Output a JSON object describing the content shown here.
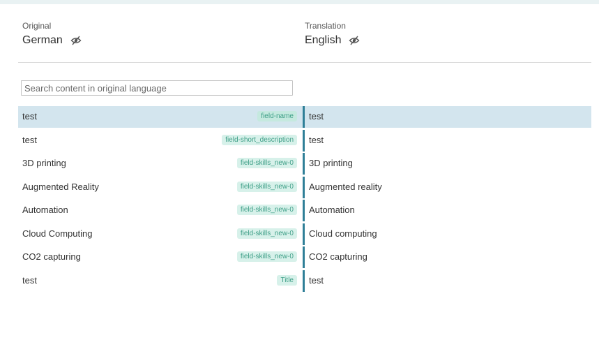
{
  "original": {
    "caption": "Original",
    "language": "German"
  },
  "translation": {
    "caption": "Translation",
    "language": "English"
  },
  "icons": {
    "visibility": "eye-slash-icon"
  },
  "colors": {
    "accent": "#2f7f97",
    "tag_bg": "#d7f1ea",
    "tag_text": "#3d9e86",
    "selected_row": "#d3e5ee"
  },
  "search": {
    "placeholder": "Search content in original language",
    "value": ""
  },
  "rows": [
    {
      "original": "test",
      "tag": "field-name",
      "translation": "test",
      "selected": true
    },
    {
      "original": "test",
      "tag": "field-short_description",
      "translation": "test",
      "selected": false
    },
    {
      "original": "3D printing",
      "tag": "field-skills_new-0",
      "translation": "3D printing",
      "selected": false
    },
    {
      "original": "Augmented Reality",
      "tag": "field-skills_new-0",
      "translation": "Augmented reality",
      "selected": false
    },
    {
      "original": "Automation",
      "tag": "field-skills_new-0",
      "translation": "Automation",
      "selected": false
    },
    {
      "original": "Cloud Computing",
      "tag": "field-skills_new-0",
      "translation": "Cloud computing",
      "selected": false
    },
    {
      "original": "CO2 capturing",
      "tag": "field-skills_new-0",
      "translation": "CO2 capturing",
      "selected": false
    },
    {
      "original": "test",
      "tag": "Title",
      "translation": "test",
      "selected": false
    }
  ]
}
